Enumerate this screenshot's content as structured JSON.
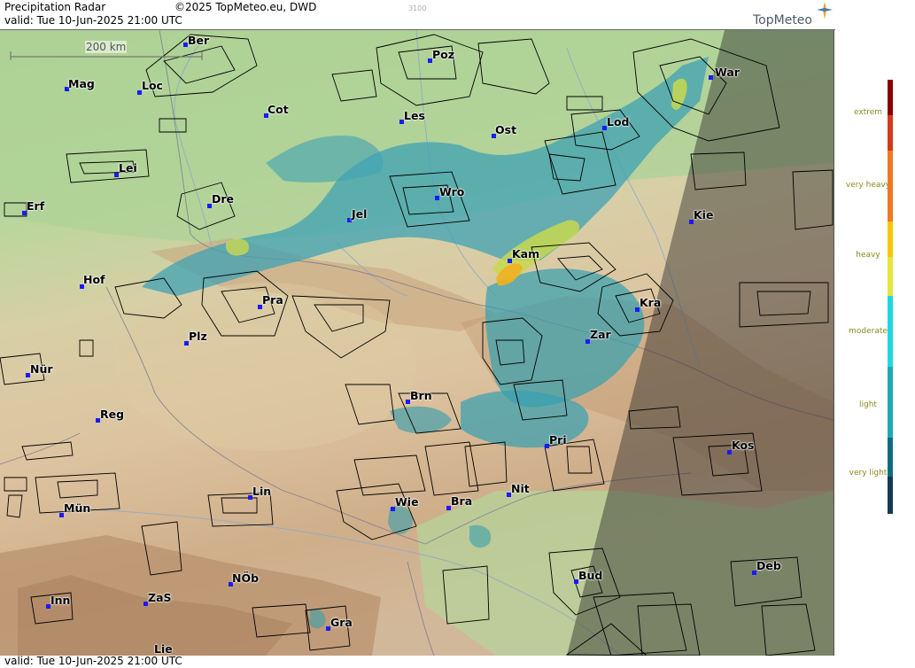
{
  "header": {
    "title": "Precipitation Radar",
    "copyright": "©2025 TopMeteo.eu, DWD",
    "code": "3100",
    "brand": "TopMeteo",
    "valid_top": "valid:  Tue  10-Jun-2025 21:00 UTC"
  },
  "footer": {
    "valid_bottom": "valid:  Tue  10-Jun-2025 21:00 UTC"
  },
  "map": {
    "scale_label": "200 km",
    "cities": [
      "Ber",
      "Poz",
      "War",
      "Mag",
      "Loc",
      "Cot",
      "Les",
      "Lod",
      "Ost",
      "Lei",
      "Dre",
      "Wro",
      "Jel",
      "Kie",
      "Erf",
      "Kam",
      "Hof",
      "Pra",
      "Kra",
      "Plz",
      "Zar",
      "Nür",
      "Brn",
      "Reg",
      "Pri",
      "Kos",
      "Lin",
      "Nit",
      "Wie",
      "Bra",
      "Mün",
      "Bud",
      "NÖb",
      "Deb",
      "Inn",
      "ZaS",
      "Gra",
      "Lie"
    ]
  },
  "legend": {
    "labels": [
      "extrem",
      "very heavy",
      "heavy",
      "moderate",
      "light",
      "very light"
    ],
    "colors": [
      "#8b0000",
      "#d43a1a",
      "#f07820",
      "#f5c800",
      "#e6e63c",
      "#20d8e0",
      "#1fa8b8",
      "#0f6d80",
      "#123a52"
    ]
  }
}
